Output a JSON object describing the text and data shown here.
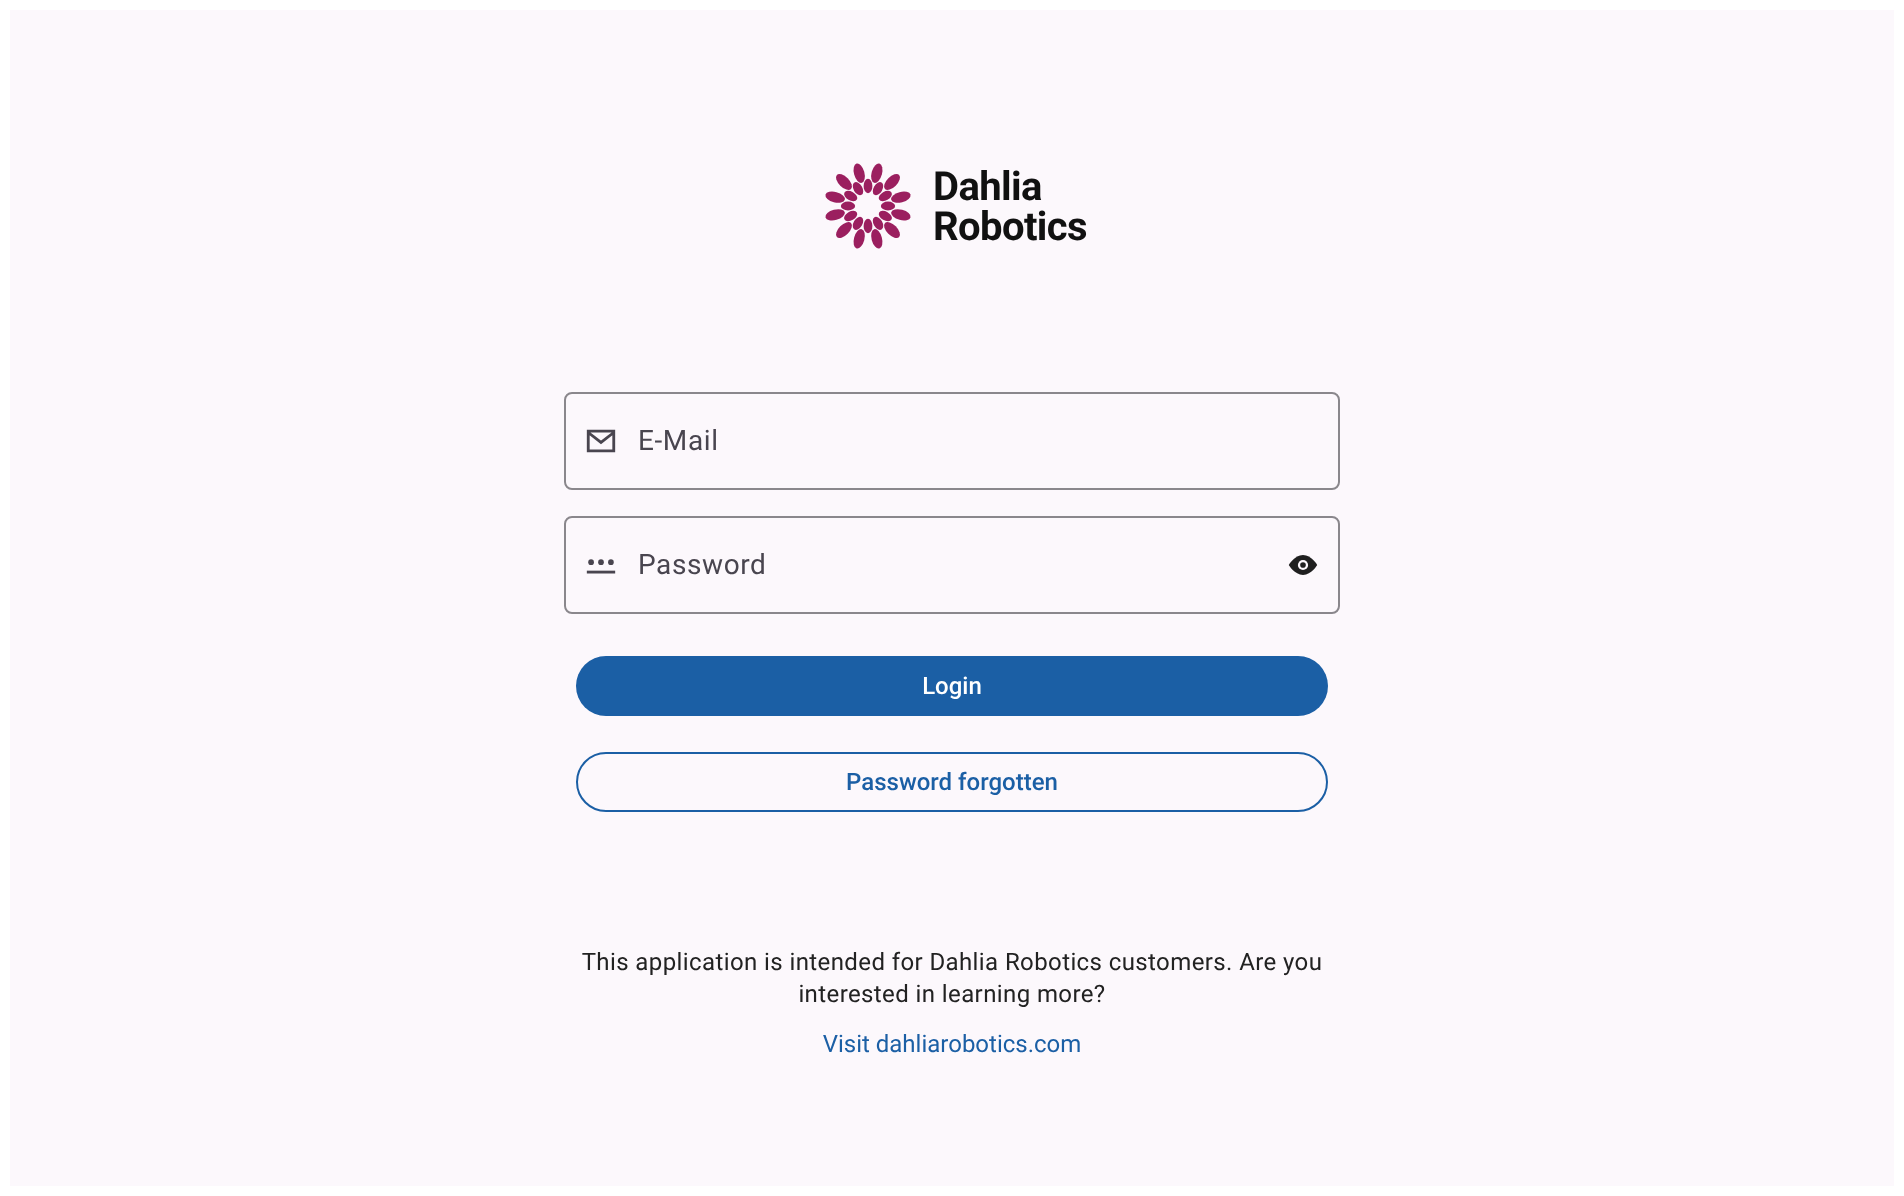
{
  "logo": {
    "name_line_1": "Dahlia",
    "name_line_2": "Robotics"
  },
  "fields": [
    {
      "kind": "email",
      "placeholder": "E-Mail"
    },
    {
      "kind": "password",
      "placeholder": "Password"
    }
  ],
  "buttons": [
    {
      "kind": "filled",
      "label": "Login"
    },
    {
      "kind": "outlined",
      "label": "Password forgotten"
    }
  ],
  "info_text": "This application is intended for Dahlia Robotics customers. Are you interested in learning more?",
  "link": "Visit dahliarobotics.com"
}
